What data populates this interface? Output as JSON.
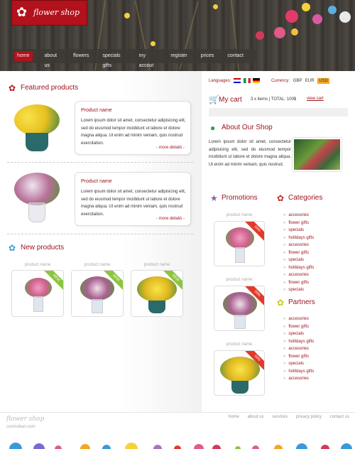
{
  "header": {
    "logo_text": "flower shop",
    "nav": [
      "home",
      "about us",
      "flowers",
      "specials gifts",
      "my accout",
      "register",
      "prices",
      "contact"
    ]
  },
  "featured": {
    "title": "Featured products",
    "items": [
      {
        "name": "Product name",
        "description": "Lorem ipsum dolor sit amet, consectetur adipisicing elit, sed do eiusmod tempor incididunt ut labore et dolore magna aliqua. Ut enim ad minim veniam, quis nostrud exercitation.",
        "more": "- more details -"
      },
      {
        "name": "Product name",
        "description": "Lorem ipsum dolor sit amet, consectetur adipisicing elit, sed do eiusmod tempor incididunt ut labore et dolore magna aliqua. Ut enim ad minim veniam, quis nostrud exercitation.",
        "more": "- more details -"
      }
    ]
  },
  "new_products": {
    "title": "New products",
    "items": [
      {
        "label": "product name",
        "badge": "NEW"
      },
      {
        "label": "product name",
        "badge": "NEW"
      },
      {
        "label": "product name",
        "badge": "NEW"
      }
    ]
  },
  "top_bar": {
    "languages_label": "Languages:",
    "currency_label": "Currency:",
    "currencies": [
      "GBP",
      "EUR",
      "USD"
    ]
  },
  "cart": {
    "title": "My cart",
    "info": "3 x items | TOTAL: 100$",
    "view_link": "view cart"
  },
  "about": {
    "title": "About Our Shop",
    "text": "Lorem ipsum dolor sit amet, consectetur adipisicing elit, sed do eiusmod tempor incididunt ut labore et dolore magna aliqua. Ut enim ad minim veniam, quis nostrud."
  },
  "promotions": {
    "title": "Promotions",
    "items": [
      {
        "label": "product name",
        "badge": "50%"
      },
      {
        "label": "product name",
        "badge": "50%"
      },
      {
        "label": "product name",
        "badge": "50%"
      }
    ]
  },
  "categories": {
    "title": "Categories",
    "items": [
      "accesories",
      "flower gifts",
      "specials",
      "hollidays gifts",
      "accesories",
      "flower gifts",
      "specials",
      "hollidays gifts",
      "accesories",
      "flower gifts",
      "specials"
    ]
  },
  "partners": {
    "title": "Partners",
    "items": [
      "accesories",
      "flower gifts",
      "specials",
      "hollidays gifts",
      "accesories",
      "flower gifts",
      "specials",
      "hollidays gifts",
      "accesories"
    ]
  },
  "footer": {
    "logo_text": "flower shop",
    "copyright": "cosmoban.com",
    "links": [
      "home",
      "about us",
      "services",
      "privacy policy",
      "contact us"
    ]
  },
  "colors": {
    "accent": "#a0141c",
    "logo_bg": "#b2121b",
    "usd_badge": "#f5a623",
    "new_ribbon": "#8cc63f",
    "promo_ribbon": "#e23a2a"
  },
  "icons": {
    "featured": "flower-icon",
    "new_products": "blue-flower-icon",
    "cart": "cart-icon",
    "about": "globe-icon",
    "promotions": "star-icon",
    "categories": "red-flower-icon",
    "partners": "yellow-flower-icon"
  }
}
